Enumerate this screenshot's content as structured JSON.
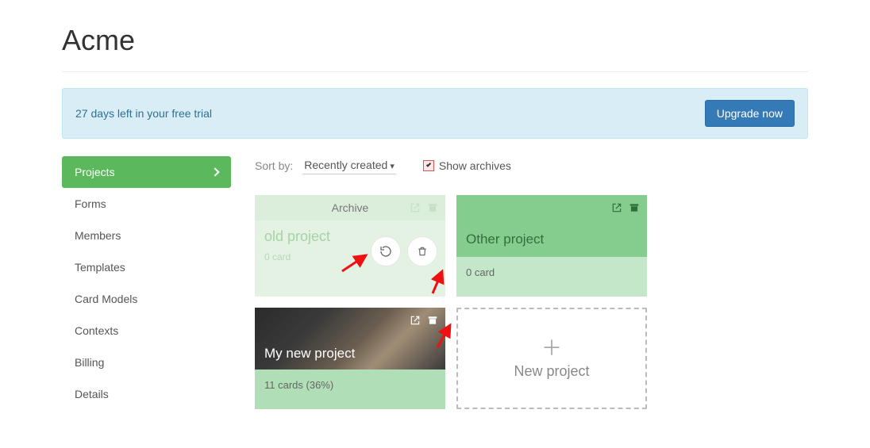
{
  "page": {
    "title": "Acme"
  },
  "alert": {
    "text": "27 days left in your free trial",
    "button": "Upgrade now"
  },
  "sidebar": {
    "items": [
      {
        "label": "Projects",
        "active": true
      },
      {
        "label": "Forms"
      },
      {
        "label": "Members"
      },
      {
        "label": "Templates"
      },
      {
        "label": "Card Models"
      },
      {
        "label": "Contexts"
      },
      {
        "label": "Billing"
      },
      {
        "label": "Details"
      }
    ]
  },
  "toolbar": {
    "sort_label": "Sort by:",
    "sort_value": "Recently created",
    "archives_label": "Show archives",
    "archives_checked": true
  },
  "projects": {
    "archive_badge": "Archive",
    "archived": {
      "name": "old project",
      "meta": "0 card"
    },
    "other": {
      "name": "Other project",
      "meta": "0 card"
    },
    "mynew": {
      "name": "My new project",
      "meta": "11 cards (36%)"
    },
    "new_label": "New project"
  }
}
